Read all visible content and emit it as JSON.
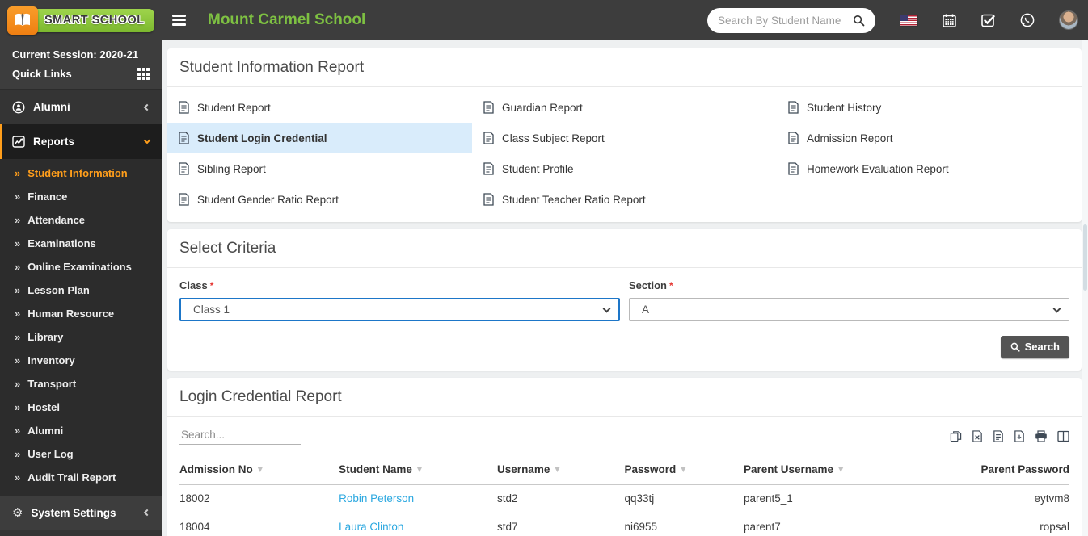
{
  "header": {
    "logo_text": "SMART SCHOOL",
    "school_name": "Mount Carmel School",
    "search_placeholder": "Search By Student Name"
  },
  "icons": {
    "submenu_arrow": "»",
    "sort_icon": "▼",
    "gear": "⚙"
  },
  "sidebar": {
    "session": "Current Session: 2020-21",
    "quick_links": "Quick Links",
    "alumni": "Alumni",
    "reports": "Reports",
    "system_settings": "System Settings",
    "submenu": [
      {
        "label": "Student Information",
        "active": true
      },
      {
        "label": "Finance"
      },
      {
        "label": "Attendance"
      },
      {
        "label": "Examinations"
      },
      {
        "label": "Online Examinations"
      },
      {
        "label": "Lesson Plan"
      },
      {
        "label": "Human Resource"
      },
      {
        "label": "Library"
      },
      {
        "label": "Inventory"
      },
      {
        "label": "Transport"
      },
      {
        "label": "Hostel"
      },
      {
        "label": "Alumni"
      },
      {
        "label": "User Log"
      },
      {
        "label": "Audit Trail Report"
      }
    ]
  },
  "report_links_card": {
    "title": "Student Information Report",
    "links": [
      {
        "label": "Student Report"
      },
      {
        "label": "Guardian Report"
      },
      {
        "label": "Student History"
      },
      {
        "label": "Student Login Credential",
        "active": true
      },
      {
        "label": "Class Subject Report"
      },
      {
        "label": "Admission Report"
      },
      {
        "label": "Sibling Report"
      },
      {
        "label": "Student Profile"
      },
      {
        "label": "Homework Evaluation Report"
      },
      {
        "label": "Student Gender Ratio Report"
      },
      {
        "label": "Student Teacher Ratio Report"
      }
    ]
  },
  "criteria": {
    "title": "Select Criteria",
    "required_marker": "*",
    "class_label": "Class",
    "class_value": "Class 1",
    "section_label": "Section",
    "section_value": "A",
    "search_button": "Search"
  },
  "report_table": {
    "title": "Login Credential Report",
    "search_placeholder": "Search...",
    "headers": [
      "Admission No",
      "Student Name",
      "Username",
      "Password",
      "Parent Username",
      "Parent Password"
    ],
    "rows": [
      {
        "admission_no": "18002",
        "student_name": "Robin Peterson",
        "username": "std2",
        "password": "qq33tj",
        "parent_username": "parent5_1",
        "parent_password": "eytvm8"
      },
      {
        "admission_no": "18004",
        "student_name": "Laura Clinton",
        "username": "std7",
        "password": "ni6955",
        "parent_username": "parent7",
        "parent_password": "ropsal"
      }
    ]
  },
  "colors": {
    "header_bg": "#3d3d3d",
    "brand_green": "#7ec142",
    "logo_orange": "#ef7f12",
    "sidebar_bg": "#343434",
    "active_orange": "#ff9e1b",
    "highlight_blue": "#d9ecfb",
    "link_blue": "#2ba8e0",
    "focus_border_blue": "#1d76c8",
    "button_gray": "#545454",
    "required_red": "#e53935",
    "page_bg": "#eef0f1"
  }
}
